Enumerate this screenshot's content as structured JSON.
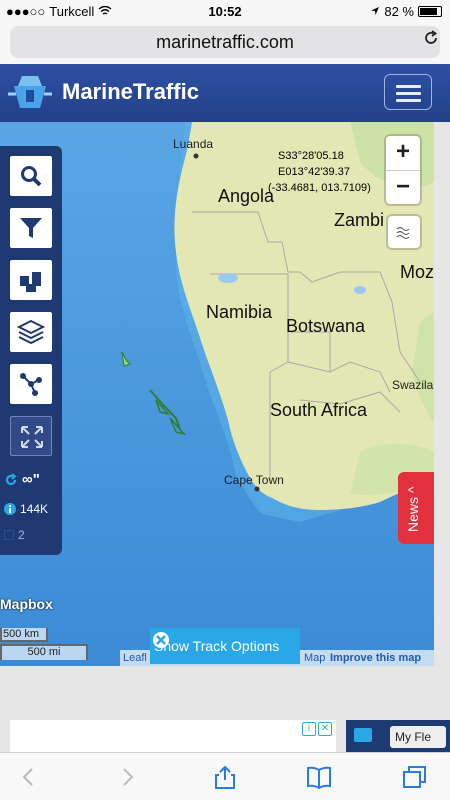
{
  "status_bar": {
    "carrier": "Turkcell",
    "time": "10:52",
    "battery": "82 %"
  },
  "browser": {
    "url": "marinetraffic.com"
  },
  "header": {
    "brand": "MarineTraffic"
  },
  "map": {
    "coordinates": {
      "lat_dms": "S33°28'05.18",
      "lon_dms": "E013°42'39.37",
      "decimal": "(-33.4681, 013.7109)"
    },
    "places": {
      "luanda": "Luanda",
      "angola": "Angola",
      "zambia": "Zambi",
      "mozambique": "Moz",
      "namibia": "Namibia",
      "botswana": "Botswana",
      "swaziland": "Swazilar",
      "south_africa": "South Africa",
      "cape_town": "Cape Town"
    },
    "zoom_in": "+",
    "zoom_out": "−",
    "mapbox_logo": "Mapbox",
    "scale_km": "500 km",
    "scale_mi": "500 mi",
    "track_options": "Show Track Options",
    "attribution_leaflet": "Leafl",
    "attribution_map": "Map",
    "attribution_improve": "Improve this map",
    "news_tab": "News ^"
  },
  "toolbar": {
    "refresh_label": "∞\"",
    "vessel_count": "144K",
    "fleet_count": "2"
  },
  "ad": {
    "my_fleet": "My Fle"
  },
  "colors": {
    "ocean": "#3f8fd8",
    "land": "#e2e6b3",
    "header": "#2a4796",
    "toolbar": "#1f3a73",
    "news": "#e1313f",
    "track_button": "#2aa7e6"
  }
}
